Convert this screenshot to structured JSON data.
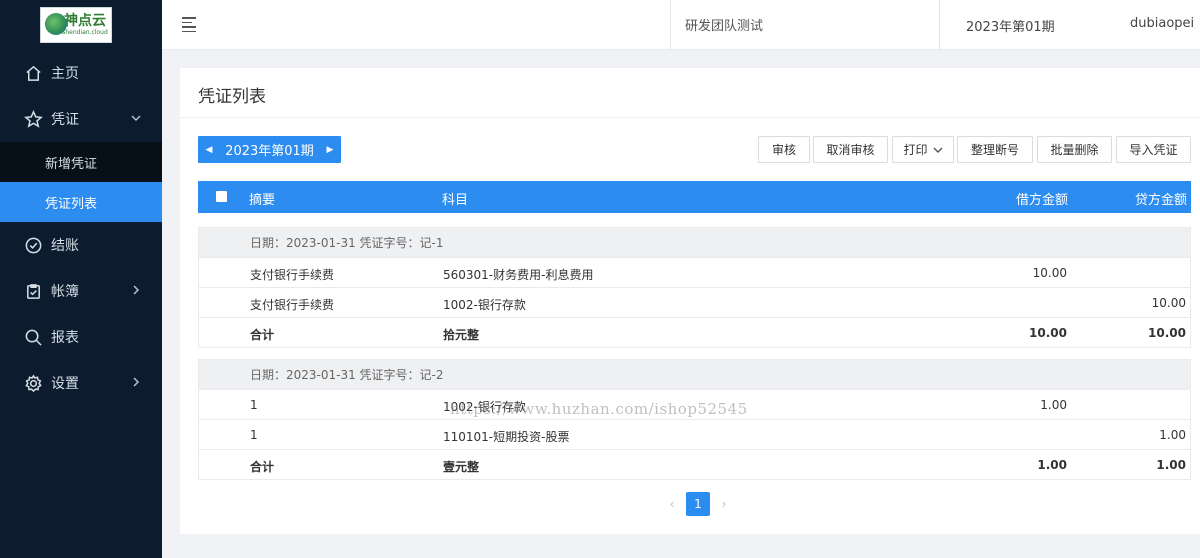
{
  "logo": {
    "name": "神点云",
    "sub": "shendian.cloud"
  },
  "sidebar": {
    "items": [
      {
        "label": "主页",
        "icon": "home-icon"
      },
      {
        "label": "凭证",
        "icon": "star-icon",
        "expanded": true,
        "children": [
          {
            "label": "新增凭证"
          },
          {
            "label": "凭证列表",
            "active": true
          }
        ]
      },
      {
        "label": "结账",
        "icon": "check-circle-icon"
      },
      {
        "label": "帐簿",
        "icon": "clipboard-icon"
      },
      {
        "label": "报表",
        "icon": "search-icon"
      },
      {
        "label": "设置",
        "icon": "gear-icon"
      }
    ]
  },
  "header": {
    "team": "研发团队测试",
    "period": "2023年第01期",
    "user": "dubiaopei"
  },
  "page": {
    "title": "凭证列表",
    "period_nav": {
      "label": "2023年第01期"
    },
    "toolbar": {
      "audit": "审核",
      "cancel_audit": "取消审核",
      "print": "打印",
      "reorder": "整理断号",
      "batch_delete": "批量删除",
      "import": "导入凭证"
    },
    "table": {
      "headers": {
        "summary": "摘要",
        "subject": "科目",
        "debit": "借方金额",
        "credit": "贷方金额"
      },
      "vouchers": [
        {
          "head": "日期：2023-01-31 凭证字号：记-1",
          "rows": [
            {
              "summary": "支付银行手续费",
              "subject": "560301-财务费用-利息费用",
              "debit": "10.00",
              "credit": ""
            },
            {
              "summary": "支付银行手续费",
              "subject": "1002-银行存款",
              "debit": "",
              "credit": "10.00"
            }
          ],
          "total": {
            "summary": "合计",
            "subject": "拾元整",
            "debit": "10.00",
            "credit": "10.00"
          }
        },
        {
          "head": "日期：2023-01-31 凭证字号：记-2",
          "rows": [
            {
              "summary": "1",
              "subject": "1002-银行存款",
              "debit": "1.00",
              "credit": ""
            },
            {
              "summary": "1",
              "subject": "110101-短期投资-股票",
              "debit": "",
              "credit": "1.00"
            }
          ],
          "total": {
            "summary": "合计",
            "subject": "壹元整",
            "debit": "1.00",
            "credit": "1.00"
          }
        }
      ]
    },
    "pagination": {
      "current": "1",
      "prev": "‹",
      "next": "›"
    }
  },
  "watermark": "https://www.huzhan.com/ishop52545",
  "colors": {
    "primary": "#2d8cf0",
    "sidebar_bg": "#0c1c2e"
  }
}
